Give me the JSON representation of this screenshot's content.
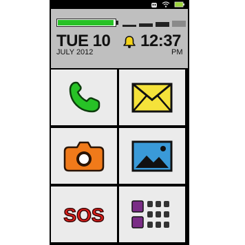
{
  "clock": {
    "date_main": "TUE 10",
    "date_sub": "JULY 2012",
    "time": "12:37",
    "ampm": "PM"
  },
  "battery_level": 0.98,
  "signal_level": 0.75,
  "status_bar_icons": [
    "android-icon",
    "wifi-icon",
    "battery-icon"
  ],
  "tiles": [
    {
      "name": "phone-tile",
      "icon": "phone-icon"
    },
    {
      "name": "messages-tile",
      "icon": "envelope-icon"
    },
    {
      "name": "camera-tile",
      "icon": "camera-icon"
    },
    {
      "name": "gallery-tile",
      "icon": "picture-icon"
    },
    {
      "name": "sos-tile",
      "icon": "sos-icon",
      "label": "SOS"
    },
    {
      "name": "apps-tile",
      "icon": "apps-grid-icon"
    }
  ],
  "colors": {
    "accent_green": "#27c226",
    "envelope_yellow": "#f5e23a",
    "camera_orange": "#f07a1a",
    "picture_blue": "#3a9ad8",
    "sos_red": "#e0201c",
    "apps_purple": "#7a2d86",
    "bell_yellow": "#f4d31a"
  }
}
